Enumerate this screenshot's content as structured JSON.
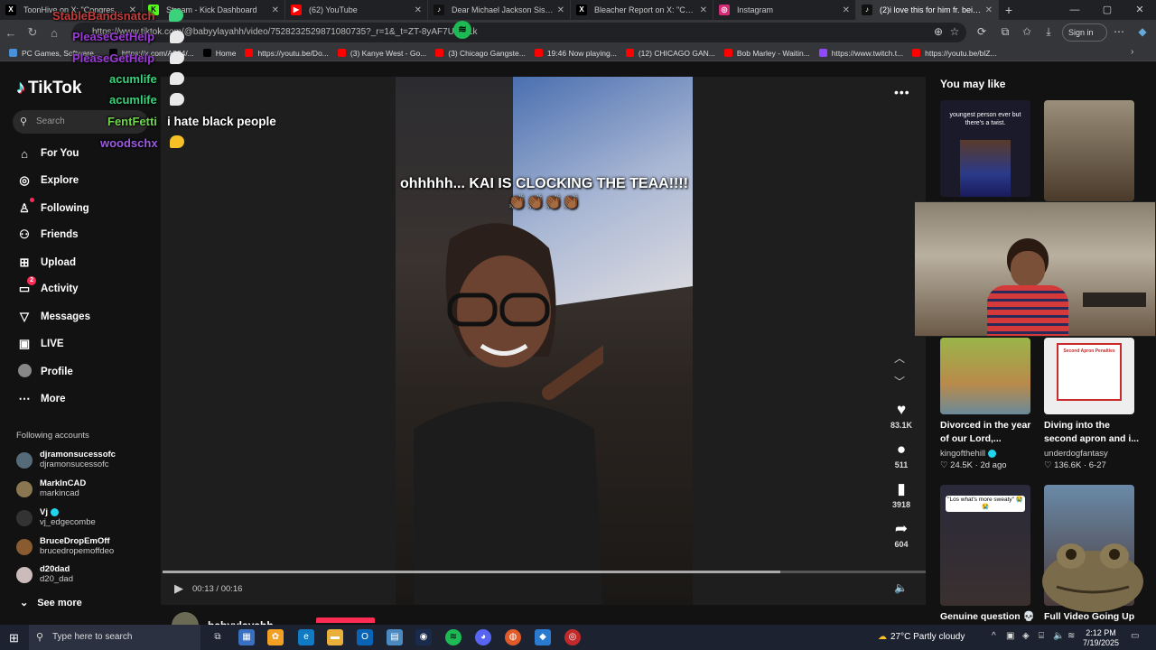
{
  "browser": {
    "tabs": [
      {
        "title": "ToonHive on X: \"Congress has it",
        "fav": "X",
        "fav_color": "#000000"
      },
      {
        "title": "Stream - Kick Dashboard",
        "fav": "K",
        "fav_color": "#53fc18"
      },
      {
        "title": "(62) YouTube",
        "fav": "▶",
        "fav_color": "#ff0000"
      },
      {
        "title": "Dear Michael Jackson Sister ♥",
        "fav": "♪",
        "fav_color": "#111111"
      },
      {
        "title": "Bleacher Report on X: \"Caitlin Cla",
        "fav": "X",
        "fav_color": "#000000"
      },
      {
        "title": "Instagram",
        "fav": "◎",
        "fav_color": "#d62976"
      },
      {
        "title": "(2)i love this for him fr. being ho",
        "fav": "♪",
        "fav_color": "#111111"
      }
    ],
    "new_tab": "+",
    "url": "https://www.tiktok.com/@babyylayahh/video/7528232529871080735?_r=1&_t=ZT-8yAF7UGN1k",
    "sign_in": "Sign in",
    "bookmarks": [
      {
        "label": "PC Games, Software...",
        "color": "#4a90d9"
      },
      {
        "label": "https://x.com/A884/...",
        "color": "#000000"
      },
      {
        "label": "Home",
        "color": "#000000"
      },
      {
        "label": "https://youtu.be/Do...",
        "color": "#ff0000"
      },
      {
        "label": "(3) Kanye West - Go...",
        "color": "#ff0000"
      },
      {
        "label": "(3) Chicago Gangste...",
        "color": "#ff0000"
      },
      {
        "label": "19:46 Now playing...",
        "color": "#ff0000"
      },
      {
        "label": "(12) CHICAGO GAN...",
        "color": "#ff0000"
      },
      {
        "label": "Bob Marley - Waitin...",
        "color": "#ff0000"
      },
      {
        "label": "https://www.twitch.t...",
        "color": "#9146ff"
      },
      {
        "label": "https://youtu.be/blZ...",
        "color": "#ff0000"
      }
    ]
  },
  "tiktok": {
    "logo": "TikTok",
    "search_placeholder": "Search",
    "nav": [
      {
        "label": "For You",
        "icon": "home-icon",
        "glyph": "⌂"
      },
      {
        "label": "Explore",
        "icon": "compass-icon",
        "glyph": "◎"
      },
      {
        "label": "Following",
        "icon": "following-icon",
        "glyph": "♙"
      },
      {
        "label": "Friends",
        "icon": "friends-icon",
        "glyph": "♙"
      },
      {
        "label": "Upload",
        "icon": "upload-icon",
        "glyph": "⊞"
      },
      {
        "label": "Activity",
        "icon": "activity-icon",
        "glyph": "▭",
        "badge": "2"
      },
      {
        "label": "Messages",
        "icon": "messages-icon",
        "glyph": "▽"
      },
      {
        "label": "LIVE",
        "icon": "live-icon",
        "glyph": "▣"
      },
      {
        "label": "Profile",
        "icon": "profile-icon",
        "glyph": "●"
      },
      {
        "label": "More",
        "icon": "more-icon",
        "glyph": "⋯"
      }
    ],
    "following_title": "Following accounts",
    "accounts": [
      {
        "name": "djramonsucessofc",
        "handle": "djramonsucessofc",
        "color": "#556b7a",
        "verified": false
      },
      {
        "name": "MarkInCAD",
        "handle": "markincad",
        "color": "#8a7650",
        "verified": false
      },
      {
        "name": "Vj",
        "handle": "vj_edgecombe",
        "color": "#333333",
        "verified": true
      },
      {
        "name": "BruceDropEmOff",
        "handle": "brucedropemoffdeo",
        "color": "#8a5a30",
        "verified": false
      },
      {
        "name": "d20dad",
        "handle": "d20_dad",
        "color": "#ccbbbb",
        "verified": false
      }
    ],
    "see_more": "See more",
    "video": {
      "caption": "ohhhhh... KAI IS CLOCKING THE TEAA!!!! 👏🏾👏🏾👏🏾👏🏾",
      "time": "00:13 / 00:16",
      "progress": 0.81,
      "likes": "83.1K",
      "comments": "511",
      "saves": "3918",
      "shares": "604",
      "author": "babyylayahh"
    },
    "you_may_like": "You may like",
    "recommendations": [
      {
        "title": "",
        "thumb_text": "youngest person ever but there's a twist.",
        "author": "",
        "likes": "",
        "date": ""
      },
      {
        "title": "",
        "thumb_text": "",
        "author": "",
        "likes": "",
        "date": ""
      },
      {
        "title": "Divorced in the year of our Lord,...",
        "author": "kingofthehill",
        "likes": "24.5K",
        "date": "2d ago",
        "verified": true
      },
      {
        "title": "Diving into the second apron and i...",
        "author": "underdogfantasy",
        "likes": "136.6K",
        "date": "6-27",
        "thumb_text": "Second Apron Penalties"
      },
      {
        "title": "Genuine question 💀",
        "thumb_text": "\"Los what's more sweaty\" 😭😭",
        "author": "",
        "likes": "",
        "date": ""
      },
      {
        "title": "Full Video Going Up",
        "author": "",
        "likes": "",
        "date": ""
      }
    ]
  },
  "overlay_chat": [
    {
      "user": "StableBandsnatch",
      "color": "#c43c3c"
    },
    {
      "user": "PleaseGetHelp",
      "color": "#9b3bd6"
    },
    {
      "user": "PleaseGetHelp",
      "color": "#9b3bd6"
    },
    {
      "user": "acumlife",
      "color": "#3ad27a"
    },
    {
      "user": "acumlife",
      "color": "#3ad27a"
    },
    {
      "user": "FentFetti",
      "color": "#6fd64a"
    },
    {
      "user": "woodschx",
      "color": "#9b5be0"
    }
  ],
  "overlay_message": "i hate black people",
  "taskbar": {
    "search_placeholder": "Type here to search",
    "weather": "27°C  Partly cloudy",
    "time": "2:12 PM",
    "date": "7/19/2025"
  }
}
